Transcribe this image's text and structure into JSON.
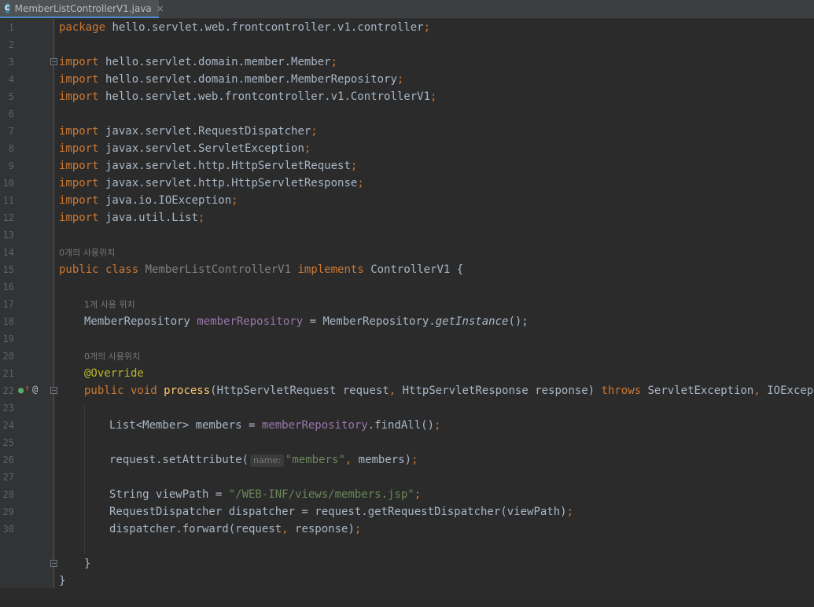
{
  "tab": {
    "icon": "C",
    "title": "MemberListControllerV1.java",
    "close": "×"
  },
  "hints": {
    "usage0_a": "0개의 사용위치",
    "usage1": "1개 사용 위치",
    "usage0_b": "0개의 사용위치",
    "param_name": "name:"
  },
  "line_numbers": [
    "1",
    "2",
    "3",
    "4",
    "5",
    "6",
    "7",
    "8",
    "9",
    "10",
    "11",
    "12",
    "13",
    "14",
    "15",
    "16",
    "17",
    "18",
    "19",
    "20",
    "21",
    "22",
    "23",
    "24",
    "25",
    "26",
    "27",
    "28",
    "29",
    "30"
  ],
  "code": {
    "l1_kw": "package",
    "l1_rest": " hello.servlet.web.frontcontroller.v1.controller",
    "l1_semi": ";",
    "import": "import",
    "l3": " hello.servlet.domain.member.Member",
    "l4": " hello.servlet.domain.member.MemberRepository",
    "l5": " hello.servlet.web.frontcontroller.v1.ControllerV1",
    "l7": " javax.servlet.RequestDispatcher",
    "l8": " javax.servlet.ServletException",
    "l9": " javax.servlet.http.HttpServletRequest",
    "l10": " javax.servlet.http.HttpServletResponse",
    "l11": " java.io.IOException",
    "l12": " java.util.List",
    "semi": ";",
    "l14_public": "public",
    "l14_class": " class ",
    "l14_name": "MemberListControllerV1",
    "l14_impl": " implements ",
    "l14_rest": "ControllerV1 {",
    "l16_type": "MemberRepository ",
    "l16_field": "memberRepository",
    "l16_eq": " = MemberRepository.",
    "l16_call": "getInstance",
    "l16_end": "();",
    "l18": "@Override",
    "l19_public": "public",
    "l19_void": " void ",
    "l19_fn": "process",
    "l19_params": "(HttpServletRequest request",
    "l19_comma": ",",
    "l19_params2": " HttpServletResponse response) ",
    "l19_throws": "throws",
    "l19_ex": " ServletException",
    "l19_comma2": ",",
    "l19_ex2": " IOException {",
    "l21_a": "List<Member> members = ",
    "l21_field": "memberRepository",
    "l21_b": ".findAll()",
    "l23_a": "request.setAttribute(",
    "l23_str": "\"members\"",
    "l23_comma": ",",
    "l23_b": " members)",
    "l25_a": "String viewPath = ",
    "l25_str": "\"/WEB-INF/views/members.jsp\"",
    "l26": "RequestDispatcher dispatcher = request.getRequestDispatcher(viewPath)",
    "l27_a": "dispatcher.forward(request",
    "l27_comma": ",",
    "l27_b": " response)",
    "l29": "}",
    "l30": "}"
  },
  "gutter_icons": {
    "override": "overridden-method-icon",
    "at": "@"
  },
  "colors": {
    "keyword": "#cc7832",
    "string": "#6a8759",
    "field": "#9876aa",
    "annotation": "#bbb529",
    "function": "#ffc66d",
    "text": "#a9b7c6",
    "background": "#2b2b2b"
  }
}
